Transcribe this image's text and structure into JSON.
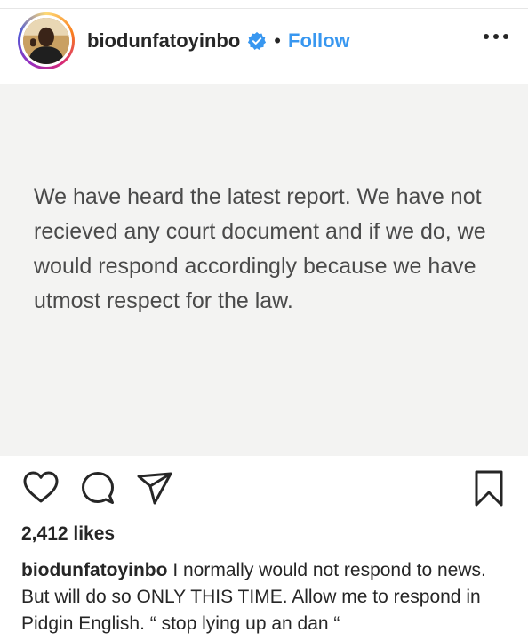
{
  "post": {
    "username": "biodunfatoyinbo",
    "separator": "•",
    "follow_label": "Follow",
    "image_text": "We have heard the latest report. We have not recieved any court document and if we do, we would respond accordingly because we have utmost respect for the law.",
    "likes": "2,412 likes",
    "caption_text": "I normally would not respond to news. But will do so ONLY THIS TIME. Allow me to respond in Pidgin English. “ stop lying up an dan “"
  },
  "icons": {
    "verified": "verified-badge-icon",
    "more": "more-options-icon",
    "like": "heart-icon",
    "comment": "comment-icon",
    "share": "send-icon",
    "save": "bookmark-icon"
  },
  "colors": {
    "link_blue": "#3897f0",
    "verified_blue": "#3897f0",
    "text_dark": "#262626",
    "image_bg": "#f3f3f2",
    "image_text": "#4a4a4a"
  }
}
